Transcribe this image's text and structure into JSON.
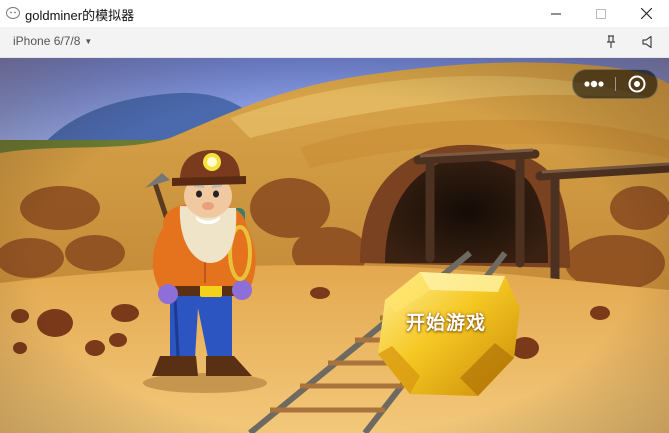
{
  "window": {
    "title": "goldminer的模拟器"
  },
  "toolbar": {
    "device": "iPhone 6/7/8"
  },
  "game": {
    "start_button_label": "开始游戏"
  },
  "icons": {
    "app": "wechat-devtools-icon",
    "minimize": "minimize-icon",
    "maximize": "maximize-icon",
    "close": "close-icon",
    "pin": "pin-icon",
    "sound": "speaker-icon",
    "more": "more-dots-icon",
    "exit": "exit-target-icon"
  },
  "colors": {
    "toolbar_bg": "#f3f3f3",
    "sky": "#7b8ed6",
    "dirt": "#d6a24a",
    "gold": "#f4c522"
  }
}
